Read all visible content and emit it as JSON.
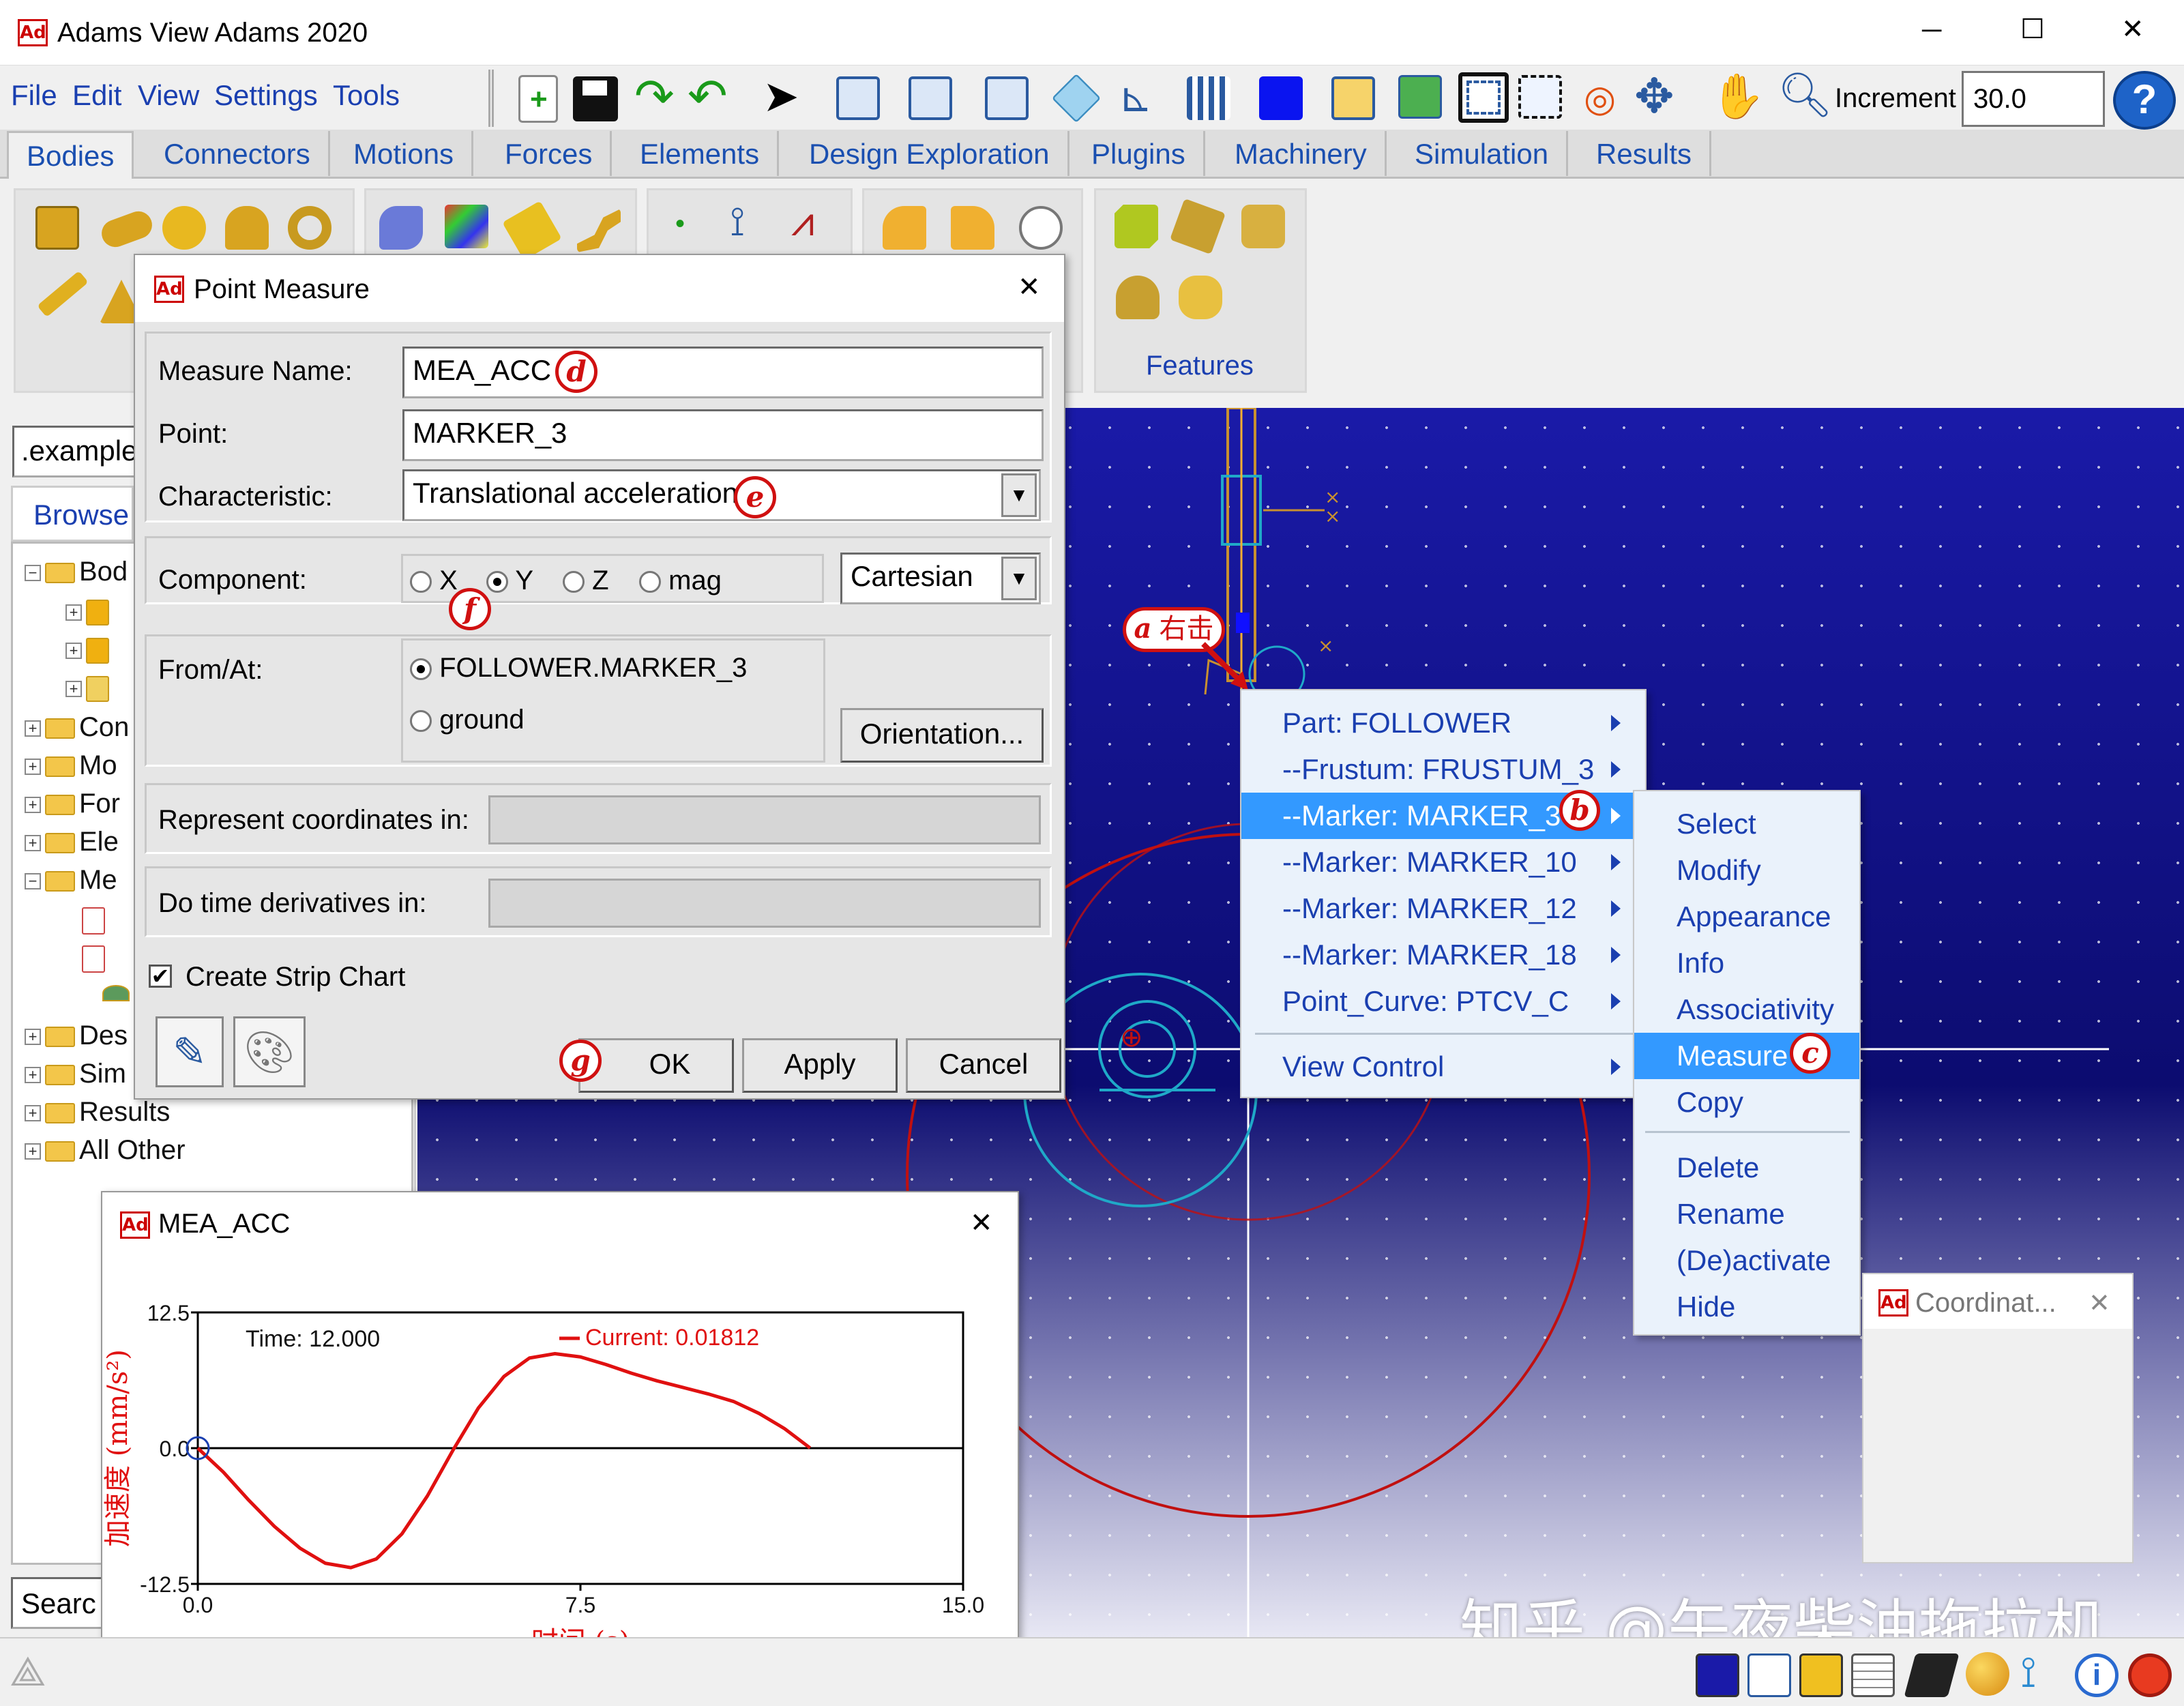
{
  "window": {
    "title": "Adams View Adams 2020",
    "min": "─",
    "max": "☐",
    "close": "✕"
  },
  "menubar": [
    "File",
    "Edit",
    "View",
    "Settings",
    "Tools"
  ],
  "toolbar": {
    "increment_label": "Increment",
    "increment_value": "30.0",
    "help": "?"
  },
  "tabs": [
    "Bodies",
    "Connectors",
    "Motions",
    "Forces",
    "Elements",
    "Design Exploration",
    "Plugins",
    "Machinery",
    "Simulation",
    "Results"
  ],
  "ribbon": {
    "features_label": "Features"
  },
  "browser": {
    "model_field": ".example",
    "browse_tab": "Browse",
    "tree": [
      "Bod",
      "Con",
      "Mo",
      "For",
      "Ele",
      "Me",
      "Des",
      "Sim",
      "Results",
      "All Other"
    ],
    "search": "Searc"
  },
  "point_measure": {
    "title": "Point Measure",
    "measure_name_label": "Measure Name:",
    "measure_name_value": "MEA_ACC",
    "point_label": "Point:",
    "point_value": "MARKER_3",
    "characteristic_label": "Characteristic:",
    "characteristic_value": "Translational acceleration",
    "component_label": "Component:",
    "components": [
      "X",
      "Y",
      "Z",
      "mag"
    ],
    "component_selected": "Y",
    "coord_system": "Cartesian",
    "from_at_label": "From/At:",
    "from_at_options": [
      "FOLLOWER.MARKER_3",
      "ground"
    ],
    "orientation_button": "Orientation...",
    "represent_label": "Represent coordinates in:",
    "derivatives_label": "Do time derivatives in:",
    "strip_chart_label": "Create Strip Chart",
    "strip_chart_checked": true,
    "ok": "OK",
    "apply": "Apply",
    "cancel": "Cancel"
  },
  "annotations": {
    "a": "a",
    "a_text": "右击",
    "b": "b",
    "c": "c",
    "d": "d",
    "e": "e",
    "f": "f",
    "g": "g"
  },
  "context_menu": {
    "items": [
      "Part: FOLLOWER",
      "--Frustum: FRUSTUM_3",
      "--Marker: MARKER_3",
      "--Marker: MARKER_10",
      "--Marker: MARKER_12",
      "--Marker: MARKER_18",
      "Point_Curve: PTCV_C",
      "View Control"
    ],
    "highlighted": "--Marker: MARKER_3"
  },
  "submenu": {
    "items": [
      "Select",
      "Modify",
      "Appearance",
      "Info",
      "Associativity",
      "Measure",
      "Copy",
      "Delete",
      "Rename",
      "(De)activate",
      "Hide"
    ],
    "highlighted": "Measure"
  },
  "coord_window": {
    "title": "Coordinat...",
    "close": "✕"
  },
  "strip_chart": {
    "title": "MEA_ACC",
    "close": "✕",
    "time_label": "Time:",
    "time_value": "12.000",
    "current_label": "Current:",
    "current_value": "0.01812",
    "ylabel": "加速度 (mm/s²)",
    "xlabel": "时间 (s)",
    "yticks": [
      "12.5",
      "0.0",
      "-12.5"
    ],
    "xticks": [
      "0.0",
      "7.5",
      "15.0"
    ]
  },
  "chart_data": {
    "type": "line",
    "title": "MEA_ACC",
    "xlabel": "时间 (s)",
    "ylabel": "加速度 (mm/s²)",
    "xlim": [
      0,
      15
    ],
    "ylim": [
      -12.5,
      12.5
    ],
    "grid": false,
    "series": [
      {
        "name": "Current",
        "color": "#e01010",
        "x": [
          0,
          0.5,
          1,
          1.5,
          2,
          2.5,
          3,
          3.5,
          4,
          4.5,
          5,
          5.5,
          6,
          6.5,
          7,
          7.5,
          8,
          8.5,
          9,
          9.5,
          10,
          10.5,
          11,
          11.5,
          12
        ],
        "y": [
          0,
          -2.2,
          -4.8,
          -7.2,
          -9.2,
          -10.6,
          -11.0,
          -10.2,
          -7.9,
          -4.4,
          -0.2,
          3.7,
          6.6,
          8.3,
          8.7,
          8.4,
          7.7,
          6.9,
          6.2,
          5.6,
          5.0,
          4.3,
          3.2,
          1.8,
          0.02
        ]
      }
    ]
  },
  "watermark": "知乎 @午夜柴油拖拉机"
}
